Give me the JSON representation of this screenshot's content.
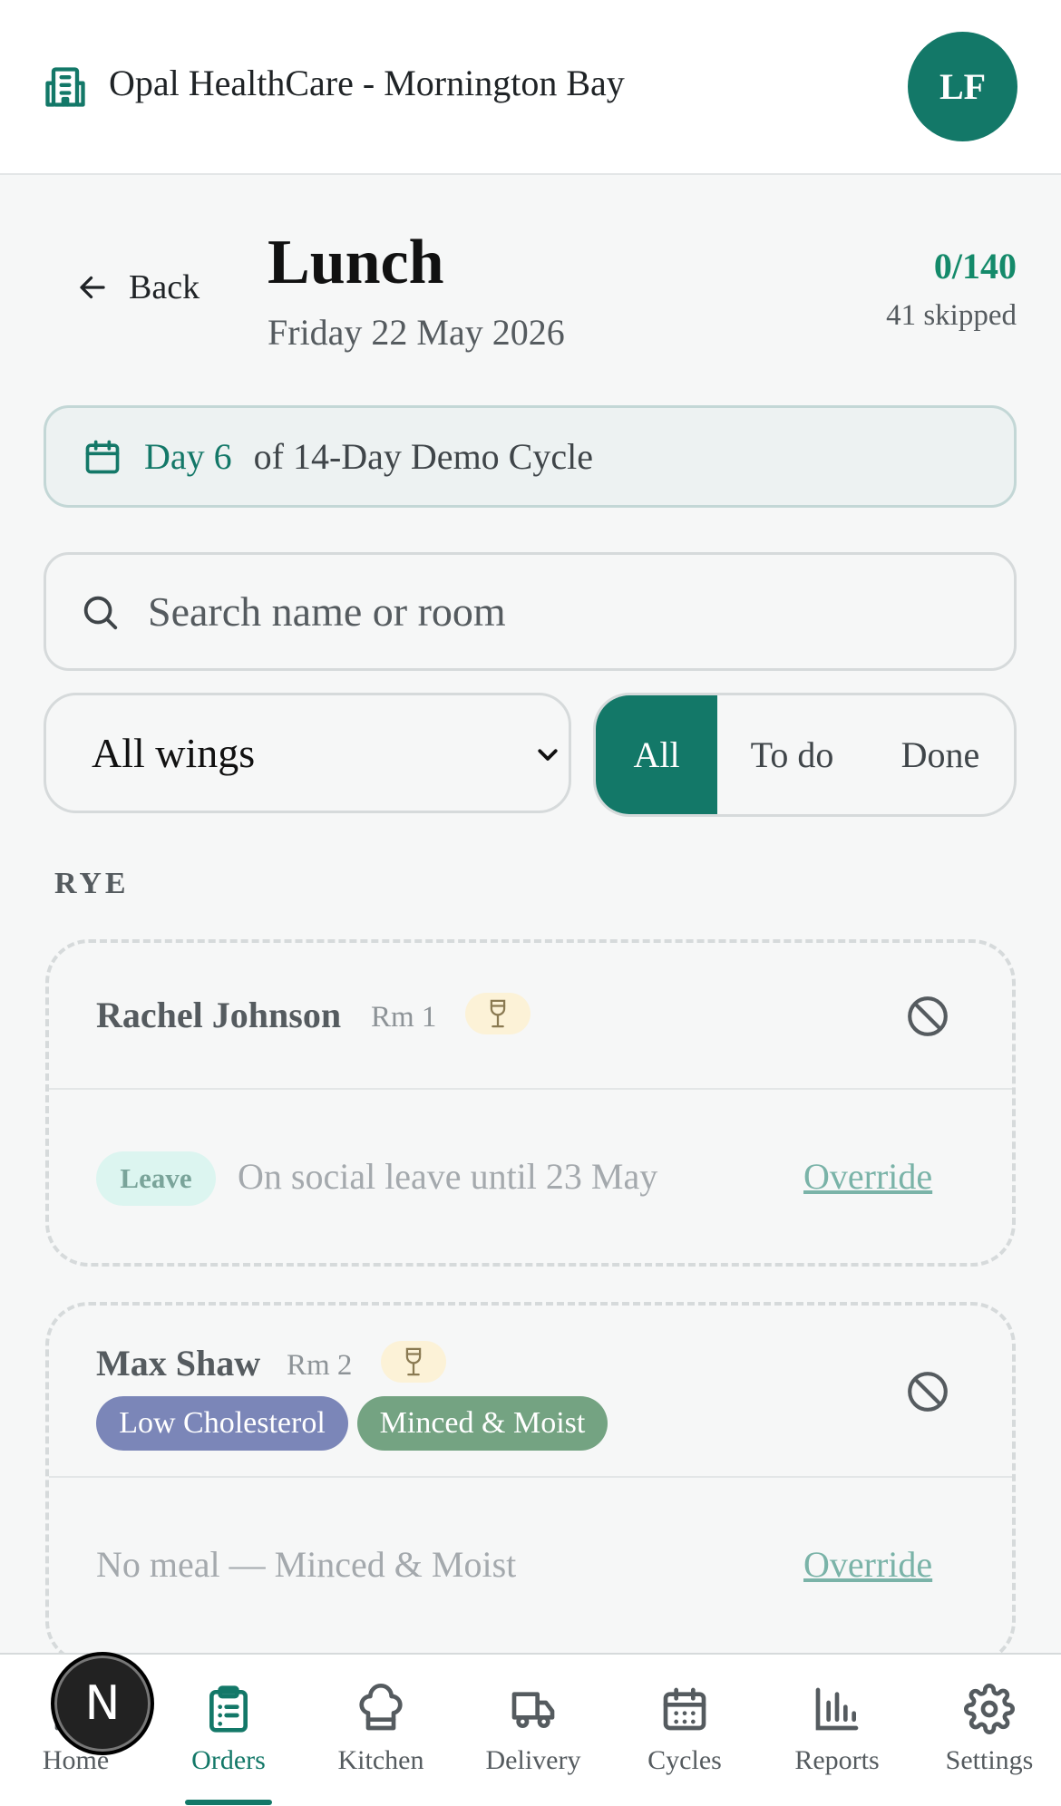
{
  "header": {
    "org_name": "Opal HealthCare - Mornington Bay",
    "avatar_initials": "LF"
  },
  "meal": {
    "back_label": "Back",
    "title": "Lunch",
    "date": "Friday 22 May 2026",
    "count": "0/140",
    "skipped": "41 skipped"
  },
  "cycle": {
    "day": "Day 6",
    "of": "of 14-Day Demo Cycle"
  },
  "search": {
    "placeholder": "Search name or room",
    "value": ""
  },
  "filters": {
    "wing_selected": "All wings",
    "segments": [
      "All",
      "To do",
      "Done"
    ],
    "active_segment": "All"
  },
  "section_label": "RYE",
  "residents": [
    {
      "name": "Rachel Johnson",
      "room": "Rm 1",
      "badge": "Leave",
      "note": "On social leave until 23 May",
      "action": "Override"
    },
    {
      "name": "Max Shaw",
      "room": "Rm 2",
      "diets": [
        "Low Cholesterol",
        "Minced & Moist"
      ],
      "note": "No meal — Minced & Moist",
      "action": "Override"
    }
  ],
  "colors": {
    "accent": "#137868",
    "count_green": "#148a6a",
    "low_cholesterol": "#7b86b8",
    "minced_moist": "#74a382"
  },
  "nav": {
    "items": [
      "Home",
      "Orders",
      "Kitchen",
      "Delivery",
      "Cycles",
      "Reports",
      "Settings"
    ],
    "active": "Orders",
    "badge_letter": "N"
  }
}
